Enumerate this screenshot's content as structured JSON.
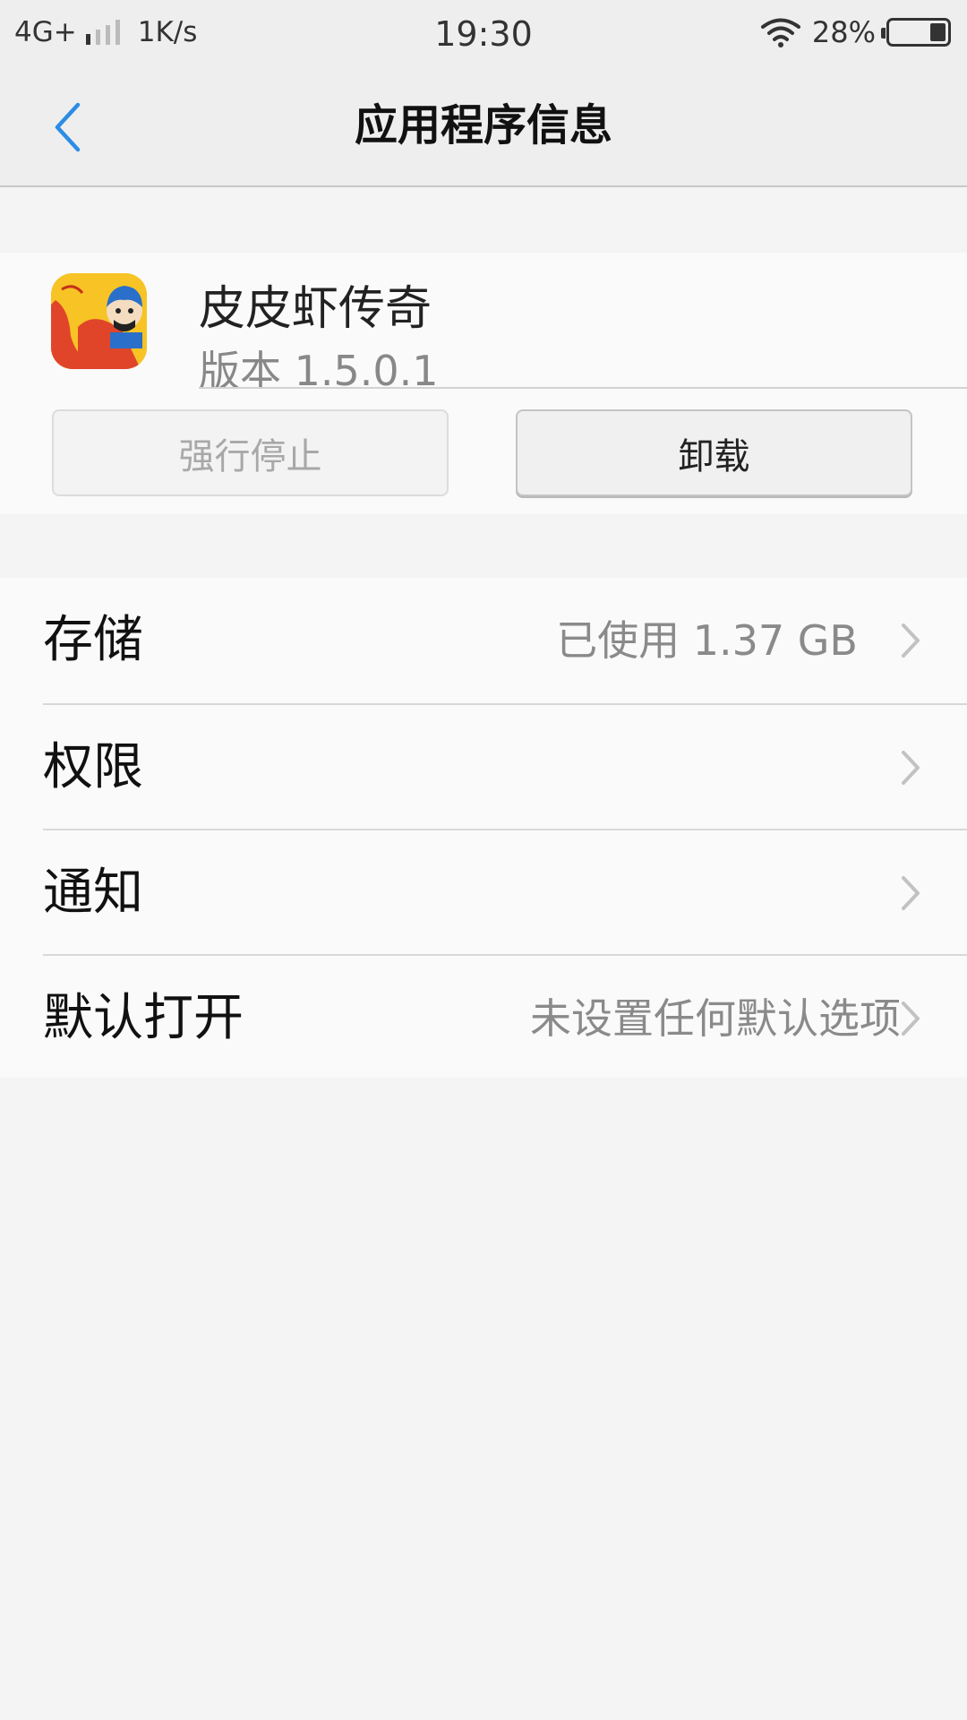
{
  "status_bar": {
    "network": "4G+",
    "speed": "1K/s",
    "time": "19:30",
    "battery_percent": "28%",
    "battery_level": 0.28,
    "signal_bars_on": 1,
    "signal_bars_total": 4
  },
  "nav": {
    "title": "应用程序信息",
    "back_icon": "chevron-left-icon",
    "accent_color": "#2b8de4"
  },
  "app": {
    "name": "皮皮虾传奇",
    "version": "版本 1.5.0.1",
    "icon_color": "#f7c325"
  },
  "actions": {
    "force_stop_label": "强行停止",
    "uninstall_label": "卸载"
  },
  "settings": {
    "items": [
      {
        "label": "存储",
        "value": "已使用 1.37 GB"
      },
      {
        "label": "权限",
        "value": ""
      },
      {
        "label": "通知",
        "value": ""
      },
      {
        "label": "默认打开",
        "value": "未设置任何默认选项"
      }
    ]
  }
}
